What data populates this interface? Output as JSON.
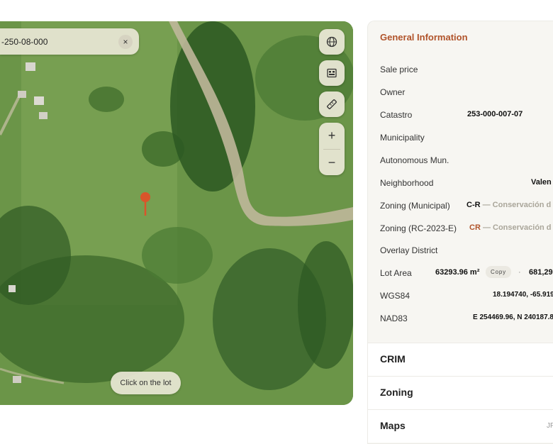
{
  "map": {
    "search_value": "-250-08-000",
    "clear_label": "×",
    "zoom_in_label": "+",
    "zoom_out_label": "−",
    "hint_label": "Click on the lot",
    "icons": [
      "globe-icon",
      "layers-icon",
      "ruler-icon"
    ]
  },
  "info": {
    "title": "General Information",
    "rows": [
      {
        "label": "Sale price",
        "value": ""
      },
      {
        "label": "Owner",
        "value": ""
      },
      {
        "label": "Catastro",
        "value": "253-000-007-07"
      },
      {
        "label": "Municipality",
        "value": ""
      },
      {
        "label": "Autonomous Mun.",
        "value": ""
      },
      {
        "label": "Neighborhood",
        "value": "Valen"
      },
      {
        "label": "Zoning (Municipal)",
        "code": "C-R",
        "desc": "— Conservación d"
      },
      {
        "label": "Zoning (RC-2023-E)",
        "code": "CR",
        "desc": "— Conservación d"
      },
      {
        "label": "Overlay District",
        "value": ""
      },
      {
        "label": "Lot Area",
        "value": "63293.96 m²",
        "copy": "Copy",
        "dot": "·",
        "alt": "681,29"
      },
      {
        "label": "WGS84",
        "value": "18.194740, -65.919"
      },
      {
        "label": "NAD83",
        "value": "E 254469.96, N 240187.8"
      }
    ]
  },
  "sections": [
    {
      "label": "CRIM",
      "sub": ""
    },
    {
      "label": "Zoning",
      "sub": ""
    },
    {
      "label": "Maps",
      "sub": "JF"
    }
  ],
  "colors": {
    "accent": "#b0532a",
    "pin": "#d9552a",
    "panel_bg": "#f7f6f2"
  }
}
